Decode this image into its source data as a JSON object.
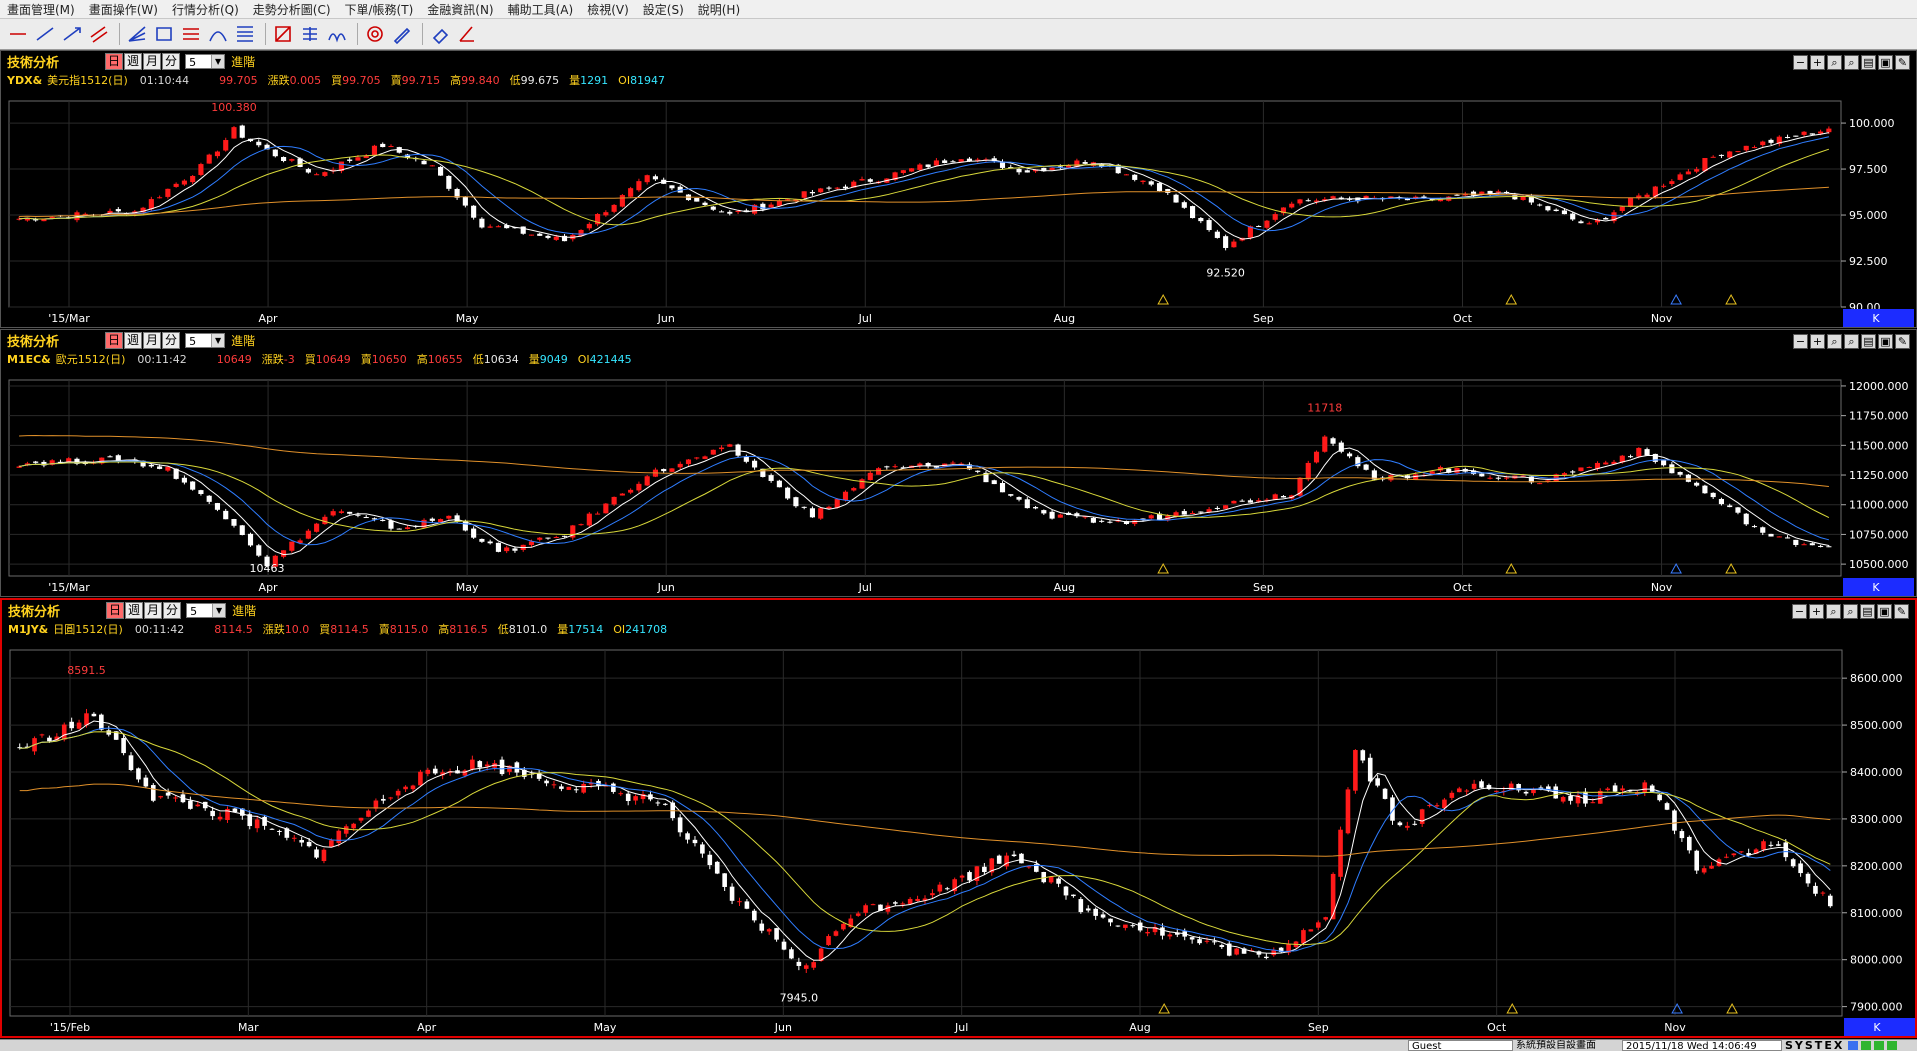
{
  "menu": [
    "畫面管理(M)",
    "畫面操作(W)",
    "行情分析(Q)",
    "走勢分析圖(C)",
    "下單/帳務(T)",
    "金融資訊(N)",
    "輔助工具(A)",
    "檢視(V)",
    "設定(S)",
    "說明(H)"
  ],
  "toolbar_icons": [
    "trendline-icon",
    "line-icon",
    "ray-icon",
    "channel-icon",
    "fib-fan-icon",
    "rect-icon",
    "parallel-icon",
    "arc-icon",
    "fib-retracement-icon",
    "gann-icon",
    "percent-icon",
    "cycle-icon",
    "spiral-icon",
    "pencil-icon",
    "erase-icon",
    "angle-icon"
  ],
  "window_buttons": [
    "−",
    "+",
    "⌕",
    "⌕",
    "▤",
    "▣",
    "✎"
  ],
  "panels": [
    {
      "title": "技術分析",
      "periods": [
        "日",
        "週",
        "月",
        "分"
      ],
      "period_value": "5",
      "adv_label": "進階",
      "k_label": "K",
      "quote": {
        "symbol": "YDX&",
        "name": "美元指1512(日)",
        "time": "01:10:44",
        "price": "99.705",
        "change_label": "漲跌",
        "change": "0.005",
        "bid_label": "買",
        "bid": "99.705",
        "ask_label": "賣",
        "ask": "99.715",
        "high_label": "高",
        "high": "99.840",
        "low_label": "低",
        "low": "99.675",
        "vol_label": "量",
        "vol": "1291",
        "oi_label": "OI",
        "oi": "81947"
      },
      "chart_data": {
        "type": "candlestick",
        "x_labels": [
          "'15/Mar",
          "Apr",
          "May",
          "Jun",
          "Jul",
          "Aug",
          "Sep",
          "Oct",
          "Nov"
        ],
        "yticks": [
          "100.000",
          "97.500",
          "95.000",
          "92.500",
          "90.00"
        ],
        "ylim": [
          90.0,
          101.2
        ],
        "annotations": [
          {
            "text": "100.380",
            "value": 100.38
          },
          {
            "text": "92.520",
            "value": 92.52
          }
        ],
        "anchors": [
          [
            0,
            94.8
          ],
          [
            14,
            95.2
          ],
          [
            22,
            97.6
          ],
          [
            26,
            99.6
          ],
          [
            30,
            98.5
          ],
          [
            36,
            97.2
          ],
          [
            44,
            98.8
          ],
          [
            50,
            97.6
          ],
          [
            56,
            94.5
          ],
          [
            66,
            93.6
          ],
          [
            76,
            97.0
          ],
          [
            86,
            95.0
          ],
          [
            94,
            96.0
          ],
          [
            104,
            97.0
          ],
          [
            114,
            98.2
          ],
          [
            122,
            97.4
          ],
          [
            130,
            98.0
          ],
          [
            138,
            96.5
          ],
          [
            146,
            93.3
          ],
          [
            154,
            95.8
          ],
          [
            162,
            95.9
          ],
          [
            170,
            95.8
          ],
          [
            180,
            96.2
          ],
          [
            190,
            94.4
          ],
          [
            196,
            96.0
          ],
          [
            206,
            98.4
          ],
          [
            214,
            99.2
          ],
          [
            219,
            99.7
          ]
        ],
        "ma_tail": [
          95.0,
          96.4
        ]
      }
    },
    {
      "title": "技術分析",
      "periods": [
        "日",
        "週",
        "月",
        "分"
      ],
      "period_value": "5",
      "adv_label": "進階",
      "k_label": "K",
      "quote": {
        "symbol": "M1EC&",
        "name": "歐元1512(日)",
        "time": "00:11:42",
        "price": "10649",
        "change_label": "漲跌",
        "change": "-3",
        "bid_label": "買",
        "bid": "10649",
        "ask_label": "賣",
        "ask": "10650",
        "high_label": "高",
        "high": "10655",
        "low_label": "低",
        "low": "10634",
        "vol_label": "量",
        "vol": "9049",
        "oi_label": "OI",
        "oi": "421445"
      },
      "chart_data": {
        "type": "candlestick",
        "x_labels": [
          "'15/Mar",
          "Apr",
          "May",
          "Jun",
          "Jul",
          "Aug",
          "Sep",
          "Oct",
          "Nov"
        ],
        "yticks": [
          "12000.000",
          "11750.000",
          "11500.000",
          "11250.000",
          "11000.000",
          "10750.000",
          "10500.000"
        ],
        "ylim": [
          10400,
          12050
        ],
        "annotations": [
          {
            "text": "11718",
            "value": 11718
          },
          {
            "text": "10463",
            "value": 10463
          }
        ],
        "anchors": [
          [
            0,
            11350
          ],
          [
            12,
            11380
          ],
          [
            18,
            11300
          ],
          [
            26,
            10850
          ],
          [
            30,
            10500
          ],
          [
            38,
            10950
          ],
          [
            46,
            10800
          ],
          [
            52,
            10900
          ],
          [
            58,
            10600
          ],
          [
            66,
            10750
          ],
          [
            76,
            11250
          ],
          [
            86,
            11480
          ],
          [
            96,
            10900
          ],
          [
            104,
            11300
          ],
          [
            114,
            11350
          ],
          [
            124,
            10900
          ],
          [
            134,
            10850
          ],
          [
            144,
            10980
          ],
          [
            154,
            11100
          ],
          [
            158,
            11600
          ],
          [
            164,
            11200
          ],
          [
            172,
            11300
          ],
          [
            184,
            11200
          ],
          [
            196,
            11450
          ],
          [
            202,
            11200
          ],
          [
            212,
            10720
          ],
          [
            219,
            10649
          ]
        ],
        "ma_tail": [
          11750,
          11150
        ]
      }
    },
    {
      "title": "技術分析",
      "periods": [
        "日",
        "週",
        "月",
        "分"
      ],
      "period_value": "5",
      "adv_label": "進階",
      "k_label": "K",
      "quote": {
        "symbol": "M1JY&",
        "name": "日圓1512(日)",
        "time": "00:11:42",
        "price": "8114.5",
        "change_label": "漲跌",
        "change": "10.0",
        "bid_label": "買",
        "bid": "8114.5",
        "ask_label": "賣",
        "ask": "8115.0",
        "high_label": "高",
        "high": "8116.5",
        "low_label": "低",
        "low": "8101.0",
        "vol_label": "量",
        "vol": "17514",
        "oi_label": "OI",
        "oi": "241708"
      },
      "chart_data": {
        "type": "candlestick",
        "x_labels": [
          "'15/Feb",
          "Mar",
          "Apr",
          "May",
          "Jun",
          "Jul",
          "Aug",
          "Sep",
          "Oct",
          "Nov"
        ],
        "yticks": [
          "8600.000",
          "8500.000",
          "8400.000",
          "8300.000",
          "8200.000",
          "8100.000",
          "8000.000",
          "7900.000"
        ],
        "ylim": [
          7880,
          8660
        ],
        "annotations": [
          {
            "text": "8591.5",
            "value": 8591.5
          },
          {
            "text": "7945.0",
            "value": 7945.0
          }
        ],
        "anchors": [
          [
            0,
            8450
          ],
          [
            10,
            8520
          ],
          [
            18,
            8350
          ],
          [
            30,
            8300
          ],
          [
            40,
            8230
          ],
          [
            52,
            8380
          ],
          [
            62,
            8420
          ],
          [
            72,
            8380
          ],
          [
            86,
            8340
          ],
          [
            96,
            8130
          ],
          [
            106,
            7980
          ],
          [
            112,
            8100
          ],
          [
            124,
            8150
          ],
          [
            134,
            8230
          ],
          [
            144,
            8100
          ],
          [
            156,
            8050
          ],
          [
            168,
            8000
          ],
          [
            176,
            8100
          ],
          [
            180,
            8450
          ],
          [
            186,
            8280
          ],
          [
            196,
            8380
          ],
          [
            210,
            8340
          ],
          [
            220,
            8370
          ],
          [
            226,
            8200
          ],
          [
            236,
            8250
          ],
          [
            244,
            8114
          ]
        ],
        "ma_tail": [
          8300,
          8300
        ]
      }
    }
  ],
  "status": {
    "user": "Guest",
    "layout": "系統預設自設畫面",
    "datetime": "2015/11/18 Wed 14:06:49",
    "brand": "SYSTEX"
  },
  "colors": {
    "up": "#ff1a1a",
    "down": "#ffffff",
    "ma5": "#ffffff",
    "ma10": "#2f7dff",
    "ma20": "#d7d73a",
    "ma60": "#e0902a",
    "grid": "#303030",
    "accent": "#ffd21f"
  }
}
